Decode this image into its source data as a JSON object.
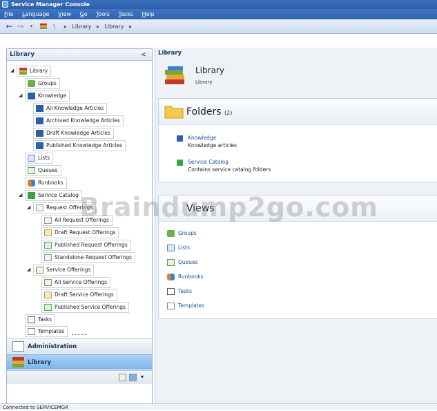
{
  "window": {
    "title": "Service Manager Console"
  },
  "menu": [
    "File",
    "Language",
    "View",
    "Go",
    "Tools",
    "Tasks",
    "Help"
  ],
  "nav": {
    "breadcrumbs": [
      "\\",
      "Library",
      "Library"
    ]
  },
  "left_pane": {
    "header": "Library",
    "collapse_glyph": "<",
    "tree": {
      "library": "Library",
      "groups": "Groups",
      "knowledge": "Knowledge",
      "all_knowledge": "All Knowledge Articles",
      "archived_knowledge": "Archived Knowledge Articles",
      "draft_knowledge": "Draft Knowledge Articles",
      "published_knowledge": "Published Knowledge Articles",
      "lists": "Lists",
      "queues": "Queues",
      "runbooks": "Runbooks",
      "service_catalog": "Service Catalog",
      "request_offerings": "Request Offerings",
      "all_request": "All Request Offerings",
      "draft_request": "Draft Request Offerings",
      "published_request": "Published Request Offerings",
      "standalone_request": "Standalone Request Offerings",
      "service_offerings": "Service Offerings",
      "all_service": "All Service Offerings",
      "draft_service": "Draft Service Offerings",
      "published_service": "Published Service Offerings",
      "tasks": "Tasks",
      "templates": "Templates"
    },
    "wunderbar": {
      "administration": "Administration",
      "library": "Library"
    }
  },
  "right_pane": {
    "label": "Library",
    "header": {
      "title": "Library",
      "subtitle": "Library"
    },
    "folders": {
      "title": "Folders",
      "count": "(2)",
      "items": [
        {
          "name": "Knowledge",
          "description": "Knowledge articles"
        },
        {
          "name": "Service Catalog",
          "description": "Contains service catalog folders"
        }
      ]
    },
    "views": {
      "title": "Views",
      "items": [
        "Groups",
        "Lists",
        "Queues",
        "Runbooks",
        "Tasks",
        "Templates"
      ]
    }
  },
  "watermark": "Braindump2go.com",
  "status": "Connected to SERVICEMGR"
}
